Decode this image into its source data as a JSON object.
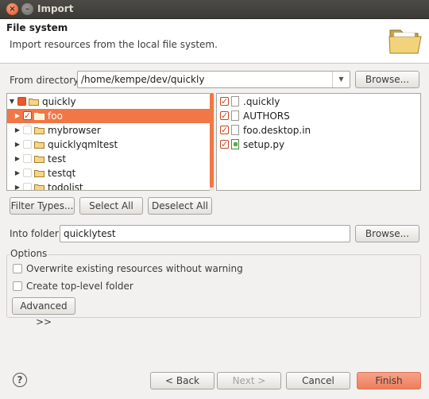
{
  "window": {
    "title": "Import",
    "close_glyph": "×",
    "min_glyph": "–"
  },
  "banner": {
    "title": "File system",
    "description": "Import resources from the local file system.",
    "icon": "open-folder-icon"
  },
  "from_directory": {
    "label": "From directory:",
    "value": "/home/kempe/dev/quickly",
    "browse_label": "Browse..."
  },
  "tree": {
    "items": [
      {
        "label": "quickly",
        "state": "partial",
        "expanded": true
      },
      {
        "label": "foo",
        "state": "checked",
        "selected": true
      },
      {
        "label": "mybrowser",
        "state": "unchecked"
      },
      {
        "label": "quicklyqmltest",
        "state": "unchecked"
      },
      {
        "label": "test",
        "state": "unchecked"
      },
      {
        "label": "testqt",
        "state": "unchecked"
      },
      {
        "label": "todolist",
        "state": "unchecked"
      }
    ]
  },
  "files": [
    {
      "label": ".quickly",
      "icon": "text-file-icon"
    },
    {
      "label": "AUTHORS",
      "icon": "text-file-icon"
    },
    {
      "label": "foo.desktop.in",
      "icon": "text-file-icon"
    },
    {
      "label": "setup.py",
      "icon": "python-file-icon"
    }
  ],
  "selection_buttons": {
    "filter_types": "Filter Types...",
    "select_all": "Select All",
    "deselect_all": "Deselect All"
  },
  "into_folder": {
    "label": "Into folder:",
    "value": "quicklytest",
    "browse_label": "Browse..."
  },
  "options": {
    "title": "Options",
    "overwrite_label": "Overwrite existing resources without warning",
    "create_top_level_label": "Create top-level folder",
    "advanced_label": "Advanced >>"
  },
  "footer": {
    "help_glyph": "?",
    "back_label": "< Back",
    "next_label": "Next >",
    "cancel_label": "Cancel",
    "finish_label": "Finish"
  },
  "colors": {
    "accent": "#f07746",
    "title_bar": "#3c3b37",
    "dialog_bg": "#f2f1f0"
  }
}
